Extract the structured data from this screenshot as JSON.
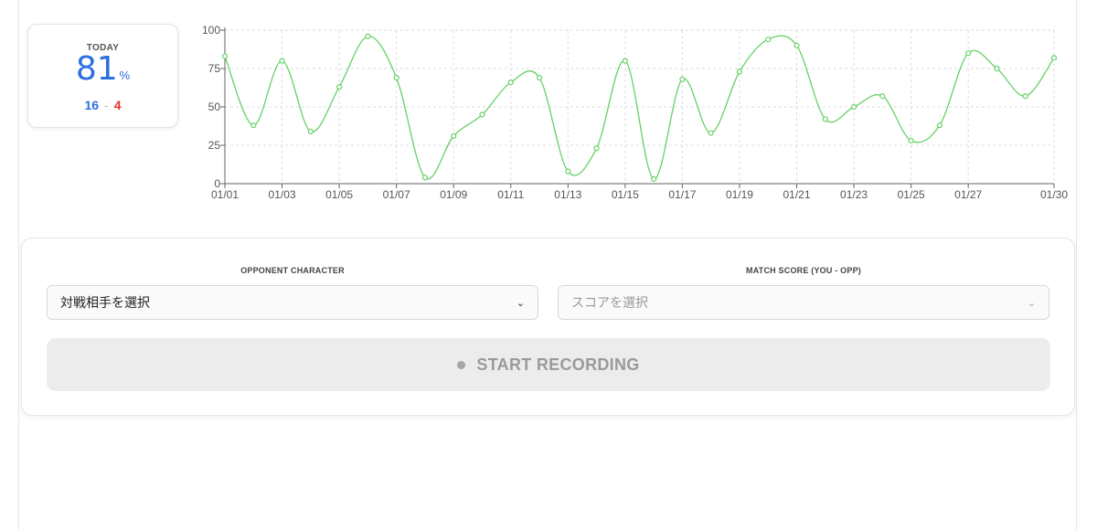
{
  "today": {
    "label": "TODAY",
    "rate": "81",
    "rate_unit": "%",
    "wins": "16",
    "separator": "-",
    "losses": "4"
  },
  "form": {
    "opponent_label": "OPPONENT CHARACTER",
    "opponent_value": "対戦相手を選択",
    "score_label": "MATCH SCORE (YOU - OPP)",
    "score_value": "スコアを選択",
    "record_button": "START RECORDING"
  },
  "colors": {
    "accent_blue": "#2b6fe0",
    "loss_red": "#e0342b",
    "line_green": "#66d166"
  },
  "chart_data": {
    "type": "line",
    "x": [
      "01/01",
      "01/02",
      "01/03",
      "01/04",
      "01/05",
      "01/06",
      "01/07",
      "01/08",
      "01/09",
      "01/10",
      "01/11",
      "01/12",
      "01/13",
      "01/14",
      "01/15",
      "01/16",
      "01/17",
      "01/18",
      "01/19",
      "01/20",
      "01/21",
      "01/22",
      "01/23",
      "01/24",
      "01/25",
      "01/26",
      "01/27",
      "01/28",
      "01/29",
      "01/30"
    ],
    "x_tick_labels": [
      "01/01",
      "01/03",
      "01/05",
      "01/07",
      "01/09",
      "01/11",
      "01/13",
      "01/15",
      "01/17",
      "01/19",
      "01/21",
      "01/23",
      "01/25",
      "01/27",
      "01/30"
    ],
    "series": [
      {
        "values": [
          83,
          38,
          80,
          34,
          63,
          96,
          69,
          4,
          31,
          45,
          66,
          69,
          8,
          23,
          80,
          3,
          68,
          33,
          73,
          94,
          90,
          42,
          50,
          57,
          28,
          38,
          85,
          75,
          57,
          82
        ]
      }
    ],
    "y_ticks": [
      0,
      25,
      50,
      75,
      100
    ],
    "ylim": [
      0,
      100
    ],
    "grid": true,
    "legend": "none"
  }
}
